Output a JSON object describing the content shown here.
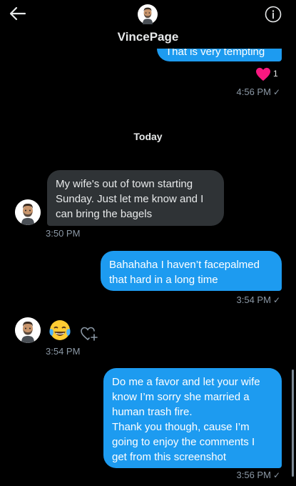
{
  "header": {
    "contact_name": "VincePage"
  },
  "messages": {
    "top_partial_text": "That is very tempting",
    "top_reaction_count": "1",
    "top_time": "4:56 PM",
    "day_separator": "Today",
    "msg1": {
      "lines": [
        "My wife's out of town starting",
        "Sunday. Just let me know and I",
        "can bring the bagels"
      ],
      "time": "3:50 PM"
    },
    "msg2": {
      "lines": [
        "Bahahaha I haven’t facepalmed",
        "that hard in a long time"
      ],
      "time": "3:54 PM"
    },
    "msg3": {
      "emoji": "😂",
      "time": "3:54 PM"
    },
    "msg4": {
      "lines": [
        "Do me a favor and let your wife",
        "know I’m sorry she married a",
        "human trash fire.",
        "Thank you though, cause I’m",
        "going to enjoy the comments I",
        "get from this screenshot"
      ],
      "time": "3:56 PM"
    },
    "read_check": "✓"
  },
  "colors": {
    "background": "#000000",
    "outgoing_bubble": "#1d9bf0",
    "incoming_bubble": "#2f3336",
    "heart": "#f91880",
    "secondary_text": "#8b98a5"
  },
  "icons": {
    "back": "back-arrow-icon",
    "info": "info-icon",
    "reaction": "heart-icon",
    "add_reaction": "heart-plus-icon"
  }
}
